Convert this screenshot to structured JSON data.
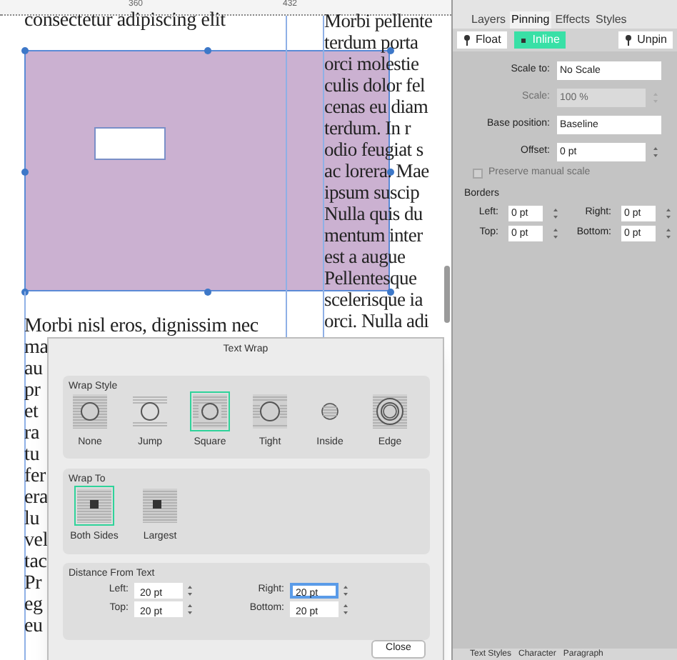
{
  "ruler": {
    "marks": [
      "360",
      "432"
    ]
  },
  "document": {
    "left_column": [
      "consectetur adipiscing elit",
      "Morbi nisl eros, dignissim nec",
      "ma",
      "au",
      "pr",
      "et",
      "ra",
      "tu",
      "fer",
      "era",
      "lu",
      "vel",
      "tac",
      "Pr",
      "eg",
      "eu"
    ],
    "right_column": [
      "Morbi pellente",
      "terdum porta",
      "orci molestie",
      "culis dolor fel",
      "cenas eu diam",
      "terdum. In r",
      "odio feugiat s",
      "ac lorera. Mae",
      "ipsum suscip",
      "Nulla quis du",
      "mentum inter",
      "est a augue",
      "Pellentesque",
      "scelerisque ia",
      "orci. Nulla adi"
    ],
    "image_frame": {
      "selected": true
    }
  },
  "dialog": {
    "title": "Text Wrap",
    "wrap_style": {
      "title": "Wrap Style",
      "options": [
        {
          "kind": "none",
          "label": "None",
          "selected": false
        },
        {
          "kind": "jump",
          "label": "Jump",
          "selected": false
        },
        {
          "kind": "square",
          "label": "Square",
          "selected": true
        },
        {
          "kind": "tight",
          "label": "Tight",
          "selected": false
        },
        {
          "kind": "inside",
          "label": "Inside",
          "selected": false
        },
        {
          "kind": "edge",
          "label": "Edge",
          "selected": false
        }
      ]
    },
    "wrap_to": {
      "title": "Wrap To",
      "options": [
        {
          "kind": "both",
          "label": "Both Sides",
          "selected": true
        },
        {
          "kind": "largest",
          "label": "Largest",
          "selected": false
        }
      ]
    },
    "distance": {
      "title": "Distance From Text",
      "fields": [
        {
          "label": "Left:",
          "value": "20 pt",
          "focused": false
        },
        {
          "label": "Right:",
          "value": "20 pt",
          "focused": true
        },
        {
          "label": "Top:",
          "value": "20 pt",
          "focused": false
        },
        {
          "label": "Bottom:",
          "value": "20 pt",
          "focused": false
        }
      ]
    },
    "close_button": "Close"
  },
  "panel": {
    "tabs": [
      {
        "label": "Layers",
        "selected": false
      },
      {
        "label": "Pinning",
        "selected": true
      },
      {
        "label": "Effects",
        "selected": false
      },
      {
        "label": "Styles",
        "selected": false
      }
    ],
    "pin_buttons": [
      {
        "kind": "float",
        "label": "Float",
        "selected": false
      },
      {
        "kind": "inline",
        "label": "Inline",
        "selected": true
      },
      {
        "kind": "unpin",
        "label": "Unpin",
        "selected": false
      }
    ],
    "rows": [
      {
        "label": "Scale to:",
        "value": "No Scale",
        "stepper": false,
        "disabled": false
      },
      {
        "label": "Scale:",
        "value": "100 %",
        "stepper": true,
        "disabled": true
      },
      {
        "label": "Base position:",
        "value": "Baseline",
        "stepper": false,
        "disabled": false
      },
      {
        "label": "Offset:",
        "value": "0 pt",
        "stepper": true,
        "disabled": false
      }
    ],
    "checkbox": {
      "label": "Preserve manual scale",
      "checked": false,
      "disabled": true
    },
    "borders": {
      "title": "Borders",
      "fields": [
        {
          "label": "Left:",
          "value": "0 pt"
        },
        {
          "label": "Right:",
          "value": "0 pt"
        },
        {
          "label": "Top:",
          "value": "0 pt"
        },
        {
          "label": "Bottom:",
          "value": "0 pt"
        }
      ]
    },
    "bottom_tabs": [
      "Text Styles",
      "Character",
      "Paragraph"
    ]
  }
}
